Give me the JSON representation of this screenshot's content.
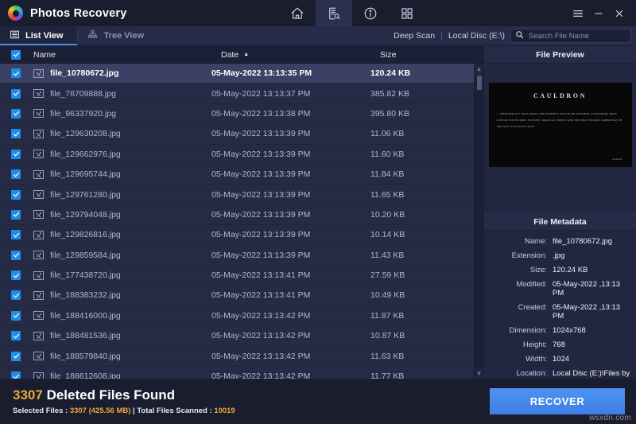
{
  "window": {
    "app_title": "Photos Recovery",
    "logo_icon": "photos-recovery-logo",
    "nav": [
      {
        "icon": "home-icon",
        "name": "home",
        "active": false
      },
      {
        "icon": "scan-document-icon",
        "name": "scan",
        "active": true
      },
      {
        "icon": "info-icon",
        "name": "info",
        "active": false
      },
      {
        "icon": "grid-icon",
        "name": "grid",
        "active": false
      }
    ],
    "controls": [
      {
        "icon": "hamburger-menu-icon",
        "glyph": "☰",
        "name": "menu"
      },
      {
        "icon": "minimize-icon",
        "glyph": "–",
        "name": "minimize"
      },
      {
        "icon": "close-icon",
        "glyph": "✕",
        "name": "close"
      }
    ]
  },
  "toolbar": {
    "tabs": [
      {
        "label": "List View",
        "icon": "list-view-icon",
        "active": true
      },
      {
        "label": "Tree View",
        "icon": "tree-view-icon",
        "active": false
      }
    ],
    "scan_mode": "Deep Scan",
    "separator": "|",
    "drive": "Local Disc (E:\\)",
    "search": {
      "icon": "search-icon",
      "placeholder": "Search File Name",
      "value": "",
      "clear_icon": "clear-icon",
      "clear_glyph": "✕"
    }
  },
  "filelist": {
    "columns": {
      "select_all": true,
      "name": "Name",
      "date": "Date",
      "sort_arrow": "▲",
      "size": "Size"
    },
    "rows": [
      {
        "checked": true,
        "name": "file_10780672.jpg",
        "date": "05-May-2022 13:13:35 PM",
        "size": "120.24 KB",
        "selected": true
      },
      {
        "checked": true,
        "name": "file_76709888.jpg",
        "date": "05-May-2022 13:13:37 PM",
        "size": "385.82 KB",
        "selected": false
      },
      {
        "checked": true,
        "name": "file_96337920.jpg",
        "date": "05-May-2022 13:13:38 PM",
        "size": "395.80 KB",
        "selected": false
      },
      {
        "checked": true,
        "name": "file_129630208.jpg",
        "date": "05-May-2022 13:13:39 PM",
        "size": "11.06 KB",
        "selected": false
      },
      {
        "checked": true,
        "name": "file_129662976.jpg",
        "date": "05-May-2022 13:13:39 PM",
        "size": "11.60 KB",
        "selected": false
      },
      {
        "checked": true,
        "name": "file_129695744.jpg",
        "date": "05-May-2022 13:13:39 PM",
        "size": "11.84 KB",
        "selected": false
      },
      {
        "checked": true,
        "name": "file_129761280.jpg",
        "date": "05-May-2022 13:13:39 PM",
        "size": "11.65 KB",
        "selected": false
      },
      {
        "checked": true,
        "name": "file_129794048.jpg",
        "date": "05-May-2022 13:13:39 PM",
        "size": "10.20 KB",
        "selected": false
      },
      {
        "checked": true,
        "name": "file_129826816.jpg",
        "date": "05-May-2022 13:13:39 PM",
        "size": "10.14 KB",
        "selected": false
      },
      {
        "checked": true,
        "name": "file_129859584.jpg",
        "date": "05-May-2022 13:13:39 PM",
        "size": "11.43 KB",
        "selected": false
      },
      {
        "checked": true,
        "name": "file_177438720.jpg",
        "date": "05-May-2022 13:13:41 PM",
        "size": "27.59 KB",
        "selected": false
      },
      {
        "checked": true,
        "name": "file_188383232.jpg",
        "date": "05-May-2022 13:13:41 PM",
        "size": "10.49 KB",
        "selected": false
      },
      {
        "checked": true,
        "name": "file_188416000.jpg",
        "date": "05-May-2022 13:13:42 PM",
        "size": "11.87 KB",
        "selected": false
      },
      {
        "checked": true,
        "name": "file_188481536.jpg",
        "date": "05-May-2022 13:13:42 PM",
        "size": "10.87 KB",
        "selected": false
      },
      {
        "checked": true,
        "name": "file_188579840.jpg",
        "date": "05-May-2022 13:13:42 PM",
        "size": "11.63 KB",
        "selected": false
      },
      {
        "checked": true,
        "name": "file_188612608.jpg",
        "date": "05-May-2022 13:13:42 PM",
        "size": "11.77 KB",
        "selected": false
      }
    ],
    "scrollbar": {
      "up_glyph": "▲",
      "down_glyph": "▼"
    }
  },
  "preview": {
    "header": "File Preview",
    "image": {
      "title": "CAULDRON",
      "body": "... whether it's tale about the earthly realm or another, cauldrons have concocted elixirs, potions, magical tonics and possibly deadly ambrosias in the not so distant past.",
      "signature": "- SAGAN"
    }
  },
  "metadata": {
    "header": "File Metadata",
    "fields": [
      {
        "label": "Name:",
        "value": "file_10780672.jpg"
      },
      {
        "label": "Extension:",
        "value": ".jpg"
      },
      {
        "label": "Size:",
        "value": "120.24 KB"
      },
      {
        "label": "Modified:",
        "value": "05-May-2022 ,13:13 PM"
      },
      {
        "label": "Created:",
        "value": "05-May-2022 ,13:13 PM"
      },
      {
        "label": "Dimension:",
        "value": "1024x768"
      },
      {
        "label": "Height:",
        "value": "768"
      },
      {
        "label": "Width:",
        "value": "1024"
      },
      {
        "label": "Location:",
        "value": "Local Disc (E:)\\Files by content\\.jpg"
      }
    ]
  },
  "status": {
    "found_count": "3307",
    "found_label": "Deleted Files Found",
    "selected_prefix": "Selected Files : ",
    "selected_count": "3307 (425.56 MB)",
    "mid_sep": " | Total Files Scanned : ",
    "total_scanned": "10019",
    "recover_label": "RECOVER"
  },
  "watermark": "wsxdn.com",
  "colors": {
    "accent": "#4a8bf0",
    "highlight": "#e9a93c",
    "checkbox": "#1f8bea",
    "titlebar_bg": "#191d2e",
    "panel_bg": "#222741"
  }
}
